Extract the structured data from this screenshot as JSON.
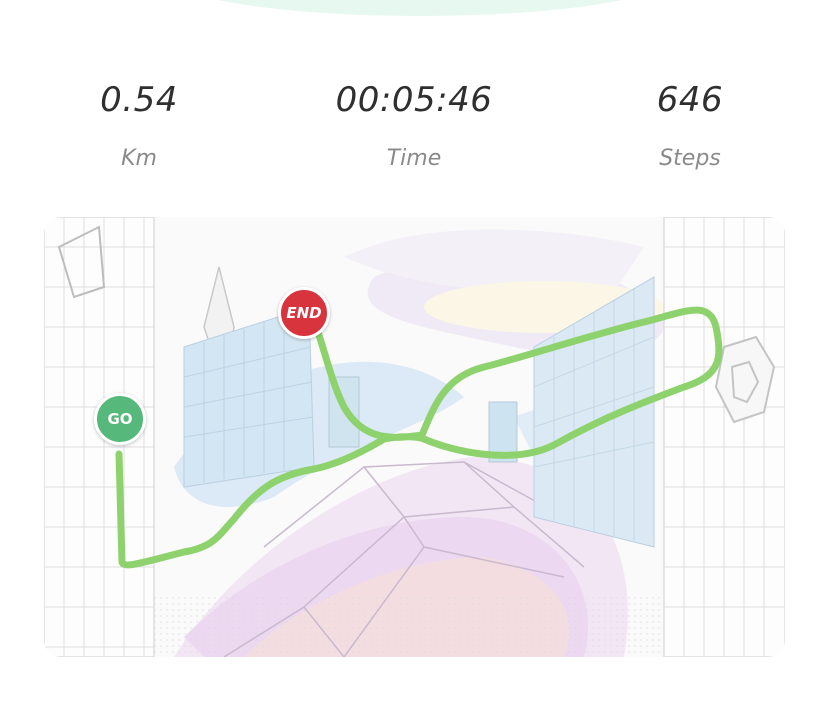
{
  "stats": {
    "distance": {
      "value": "0.54",
      "label": "Km"
    },
    "time": {
      "value": "00:05:46",
      "label": "Time"
    },
    "steps": {
      "value": "646",
      "label": "Steps"
    }
  },
  "map": {
    "start_marker": "GO",
    "end_marker": "END",
    "route_color": "#8ed26e",
    "start_color": "#56b87b",
    "end_color": "#d8343d"
  },
  "colors": {
    "accent": "#e7f8f1",
    "text": "#2f2f2f",
    "muted": "#8a8a8a"
  }
}
